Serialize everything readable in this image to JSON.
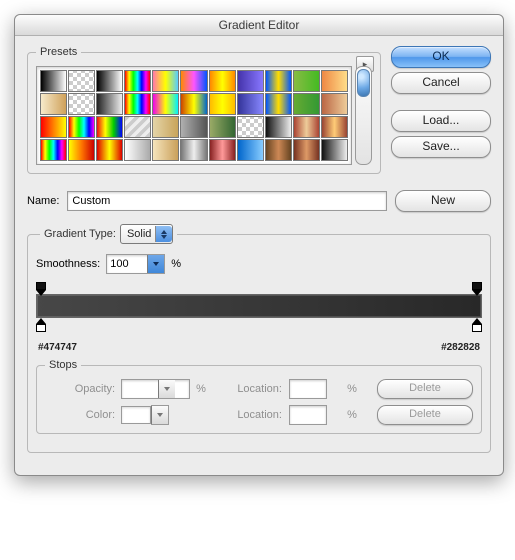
{
  "window": {
    "title": "Gradient Editor"
  },
  "buttons": {
    "ok": "OK",
    "cancel": "Cancel",
    "load": "Load...",
    "save": "Save...",
    "new": "New",
    "delete": "Delete"
  },
  "labels": {
    "presets": "Presets",
    "name": "Name:",
    "gradient_type": "Gradient Type:",
    "smoothness": "Smoothness:",
    "stops": "Stops",
    "opacity": "Opacity:",
    "color": "Color:",
    "location": "Location:",
    "percent": "%"
  },
  "fields": {
    "name_value": "Custom",
    "gradient_type_value": "Solid",
    "smoothness_value": "100",
    "opacity_value": "",
    "color_value": "",
    "opacity_location": "",
    "color_location": ""
  },
  "gradient": {
    "left_hex": "#474747",
    "right_hex": "#282828"
  },
  "presets": [
    {
      "bg": "linear-gradient(90deg,#000,#fff)"
    },
    {
      "bg": "repeating-conic-gradient(#ccc 0 25%,#fff 0 50%) 0/8px 8px"
    },
    {
      "bg": "linear-gradient(90deg,#000,#fff)"
    },
    {
      "bg": "linear-gradient(90deg,red,yellow,lime,cyan,blue,magenta,red)"
    },
    {
      "bg": "linear-gradient(90deg,#f7a,#ff0,#5cf)"
    },
    {
      "bg": "linear-gradient(90deg,#f80,#f5f,#05f)"
    },
    {
      "bg": "linear-gradient(90deg,#f80,#ff0,#f80)"
    },
    {
      "bg": "linear-gradient(90deg,#43a,#87f)"
    },
    {
      "bg": "linear-gradient(90deg,#05f,#fd0,#05f)"
    },
    {
      "bg": "linear-gradient(90deg,#8b4,#4b2)"
    },
    {
      "bg": "linear-gradient(90deg,#e84,#fd8)"
    },
    {
      "bg": "linear-gradient(90deg,#f7eacb,#cfa15a)"
    },
    {
      "bg": "repeating-conic-gradient(#ccc 0 25%,#fff 0 50%) 0/8px 8px"
    },
    {
      "bg": "linear-gradient(90deg,#222,#eee)"
    },
    {
      "bg": "linear-gradient(90deg,red,yellow,lime,cyan,blue,magenta,red)"
    },
    {
      "bg": "linear-gradient(90deg,#e0e,#ff0,#0ef)"
    },
    {
      "bg": "linear-gradient(90deg,#c40,#ff0,#06c)"
    },
    {
      "bg": "linear-gradient(90deg,#fb0,#ff0,#fb0)"
    },
    {
      "bg": "linear-gradient(90deg,#339,#88f)"
    },
    {
      "bg": "linear-gradient(90deg,#05f,#fd0,#05f)"
    },
    {
      "bg": "linear-gradient(90deg,#6a3,#393)"
    },
    {
      "bg": "linear-gradient(90deg,#b64,#ec9)"
    },
    {
      "bg": "linear-gradient(90deg,#f00,#ff0)"
    },
    {
      "bg": "linear-gradient(90deg,#f00,#ff0,#0f0,#0ff,#00f,#f0f)"
    },
    {
      "bg": "linear-gradient(90deg,#e11,#ff0,#0c0,#00f)"
    },
    {
      "bg": "linear-gradient(135deg,#eee 25%,#ccc 25%,#ccc 50%,#eee 50%,#eee 75%,#ccc 75%) 0/10px 10px"
    },
    {
      "bg": "linear-gradient(90deg,#e4d4a8,#c9a45a)"
    },
    {
      "bg": "linear-gradient(90deg,#b0b0b0,#555)"
    },
    {
      "bg": "linear-gradient(90deg,#9a6,#363)"
    },
    {
      "bg": "repeating-conic-gradient(#ccc 0 25%,#fff 0 50%) 0/8px 8px"
    },
    {
      "bg": "linear-gradient(90deg,#111,#eee)"
    },
    {
      "bg": "linear-gradient(90deg,#a43,#ec9,#a43)"
    },
    {
      "bg": "linear-gradient(90deg,#943,#fc7,#943)"
    },
    {
      "bg": "linear-gradient(90deg,red,yellow,lime,cyan,blue,magenta,red)"
    },
    {
      "bg": "linear-gradient(90deg,#ff0,#f70,#c00)"
    },
    {
      "bg": "linear-gradient(90deg,#d00,#ff0,#d00)"
    },
    {
      "bg": "linear-gradient(90deg,#fff,#aaa)"
    },
    {
      "bg": "linear-gradient(90deg,#f5e4bc,#caa05a)"
    },
    {
      "bg": "linear-gradient(90deg,#777,#eee,#777)"
    },
    {
      "bg": "linear-gradient(90deg,#822,#f99,#822)"
    },
    {
      "bg": "linear-gradient(90deg,#06c,#8cf)"
    },
    {
      "bg": "linear-gradient(90deg,#642,#c85,#642)"
    },
    {
      "bg": "linear-gradient(90deg,#732,#d96,#732)"
    },
    {
      "bg": "linear-gradient(90deg,#111,#eee)"
    }
  ]
}
